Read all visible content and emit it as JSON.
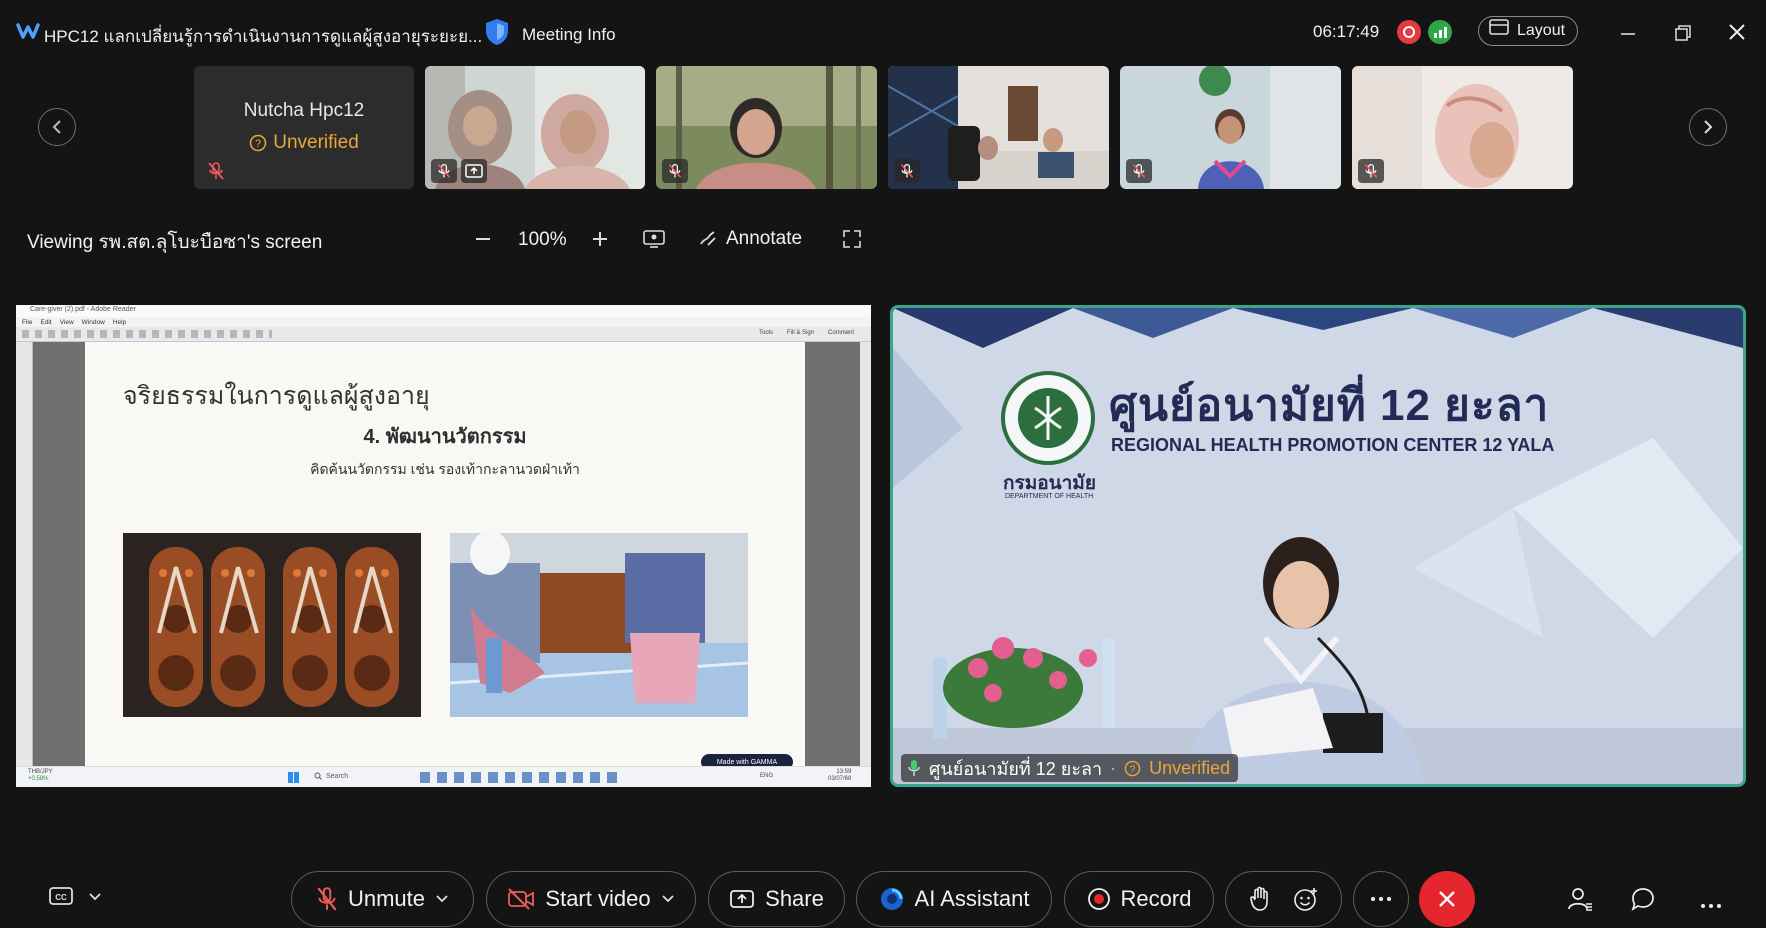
{
  "titlebar": {
    "meeting_title": "HPC12 แลกเปลี่ยนรู้การดำเนินงานการดูแลผู้สูงอายุระยะย...",
    "meeting_info_label": "Meeting Info",
    "clock": "06:17:49",
    "layout_label": "Layout"
  },
  "filmstrip": {
    "first_participant_name": "Nutcha Hpc12",
    "first_participant_status": "Unverified"
  },
  "viewing": {
    "label": "Viewing รพ.สต.ลุโบะบือซา's screen",
    "zoom": "100%",
    "annotate_label": "Annotate"
  },
  "shared_screen": {
    "window_title": "Care-giver (2).pdf - Adobe Reader",
    "menu": [
      "File",
      "Edit",
      "View",
      "Window",
      "Help"
    ],
    "toolbar_right": [
      "Tools",
      "Fill & Sign",
      "Comment"
    ],
    "slide_title": "จริยธรรมในการดูแลผู้สูงอายุ",
    "slide_heading": "4. พัฒนานวัตกรรม",
    "slide_subtext": "คิดค้นนวัตกรรม เช่น รองเท้ากะลานวดฝ่าเท้า",
    "made_with": "Made with GAMMA",
    "taskbar_search": "Search",
    "taskbar_ticker": "THB/JPY",
    "taskbar_ticker_change": "+0.58%",
    "taskbar_time": "13:59",
    "taskbar_date": "03/07/68",
    "taskbar_lang": "ENG"
  },
  "speaker": {
    "backdrop_thai": "ศูนย์อนามัยที่ 12 ยะลา",
    "backdrop_english": "REGIONAL HEALTH PROMOTION CENTER 12 YALA",
    "backdrop_logo_thai": "กรมอนามัย",
    "backdrop_logo_english": "DEPARTMENT OF HEALTH",
    "name": "ศูนย์อนามัยที่ 12 ยะลา",
    "status": "Unverified"
  },
  "controls": {
    "unmute": "Unmute",
    "start_video": "Start video",
    "share": "Share",
    "ai_assistant": "AI Assistant",
    "record": "Record"
  },
  "colors": {
    "background": "#141414",
    "unverified": "#e9a73a",
    "leave_red": "#e5262f",
    "speaker_border": "#3aa58f",
    "mute_icon": "#f05a5a"
  }
}
